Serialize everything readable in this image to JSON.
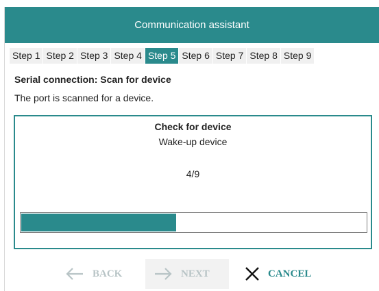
{
  "window": {
    "title": "Communication assistant"
  },
  "steps": [
    {
      "label": "Step 1",
      "active": false
    },
    {
      "label": "Step 2",
      "active": false
    },
    {
      "label": "Step 3",
      "active": false
    },
    {
      "label": "Step 4",
      "active": false
    },
    {
      "label": "Step 5",
      "active": true
    },
    {
      "label": "Step 6",
      "active": false
    },
    {
      "label": "Step 7",
      "active": false
    },
    {
      "label": "Step 8",
      "active": false
    },
    {
      "label": "Step 9",
      "active": false
    }
  ],
  "page": {
    "heading": "Serial connection: Scan for device",
    "description": "The port is scanned for a device."
  },
  "panel": {
    "title": "Check for device",
    "subtitle": "Wake-up device",
    "count": "4/9",
    "progress_fraction": 0.45
  },
  "footer": {
    "back_label": "BACK",
    "next_label": "NEXT",
    "cancel_label": "CANCEL",
    "back_icon": "arrow-left-icon",
    "next_icon": "arrow-right-icon",
    "cancel_icon": "close-icon"
  },
  "colors": {
    "accent": "#2a8a8c",
    "disabled": "#b8c4c6"
  }
}
